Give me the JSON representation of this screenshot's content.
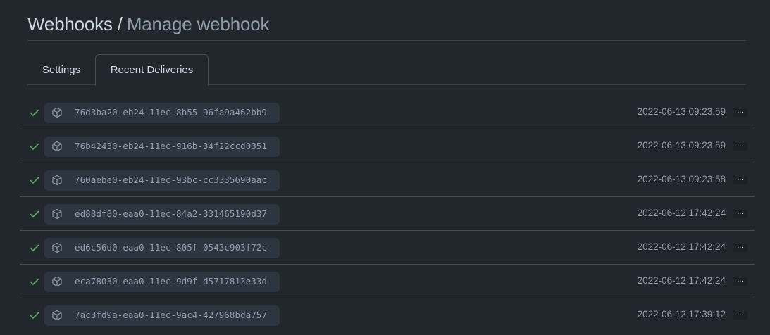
{
  "header": {
    "root": "Webhooks",
    "separator": "/",
    "current": "Manage webhook"
  },
  "tabs": [
    {
      "label": "Settings",
      "selected": false
    },
    {
      "label": "Recent Deliveries",
      "selected": true
    }
  ],
  "deliveries": [
    {
      "status": "success",
      "guid": "76d3ba20-eb24-11ec-8b55-96fa9a462bb9",
      "timestamp": "2022-06-13 09:23:59",
      "more": "···"
    },
    {
      "status": "success",
      "guid": "76b42430-eb24-11ec-916b-34f22ccd0351",
      "timestamp": "2022-06-13 09:23:59",
      "more": "···"
    },
    {
      "status": "success",
      "guid": "760aebe0-eb24-11ec-93bc-cc3335690aac",
      "timestamp": "2022-06-13 09:23:58",
      "more": "···"
    },
    {
      "status": "success",
      "guid": "ed88df80-eaa0-11ec-84a2-331465190d37",
      "timestamp": "2022-06-12 17:42:24",
      "more": "···"
    },
    {
      "status": "success",
      "guid": "ed6c56d0-eaa0-11ec-805f-0543c903f72c",
      "timestamp": "2022-06-12 17:42:24",
      "more": "···"
    },
    {
      "status": "success",
      "guid": "eca78030-eaa0-11ec-9d9f-d5717813e33d",
      "timestamp": "2022-06-12 17:42:24",
      "more": "···"
    },
    {
      "status": "success",
      "guid": "7ac3fd9a-eaa0-11ec-9ac4-427968bda757",
      "timestamp": "2022-06-12 17:39:12",
      "more": "···"
    }
  ],
  "colors": {
    "background": "#22272e",
    "success": "#57ab5a",
    "muted_text": "#909dab",
    "heading_text": "#cdd9e5",
    "border": "#444c56"
  },
  "icons": {
    "status": "check-icon",
    "delivery": "package-icon",
    "actions": "kebab-horizontal-icon"
  }
}
